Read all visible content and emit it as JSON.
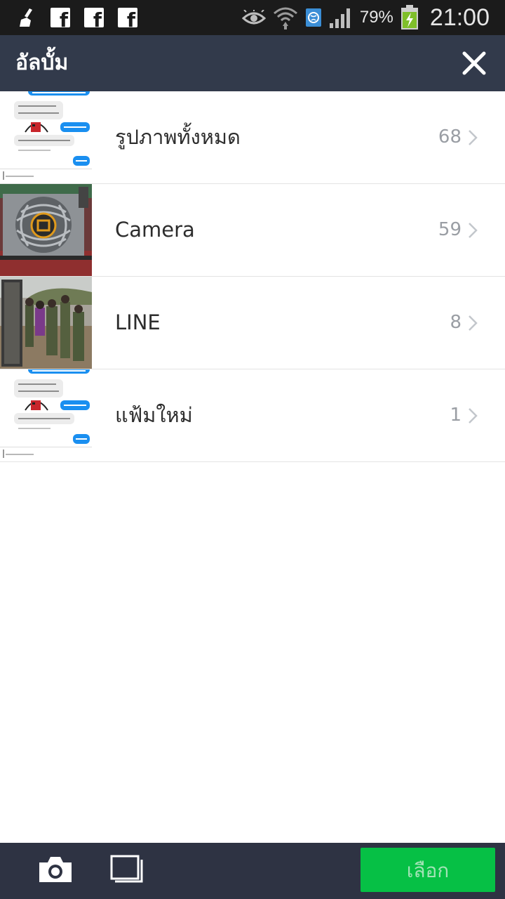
{
  "status_bar": {
    "battery_percent": "79%",
    "time": "21:00",
    "left_icons": [
      "broom-icon",
      "facebook-icon",
      "facebook-icon",
      "facebook-icon"
    ],
    "right_icons": [
      "eye-icon",
      "wifi-icon",
      "globe-icon",
      "signal-icon",
      "battery-icon"
    ]
  },
  "header": {
    "title": "อัลบั้ม"
  },
  "albums": [
    {
      "name": "รูปภาพทั้งหมด",
      "count": "68"
    },
    {
      "name": "Camera",
      "count": "59"
    },
    {
      "name": "LINE",
      "count": "8"
    },
    {
      "name": "แฟ้มใหม่",
      "count": "1"
    }
  ],
  "bottom_bar": {
    "select_label": "เลือก"
  },
  "colors": {
    "header_bg": "#323a4b",
    "bottom_bar_bg": "#2e3343",
    "select_button_bg": "#06c045",
    "select_button_text": "#a2e3b6"
  }
}
